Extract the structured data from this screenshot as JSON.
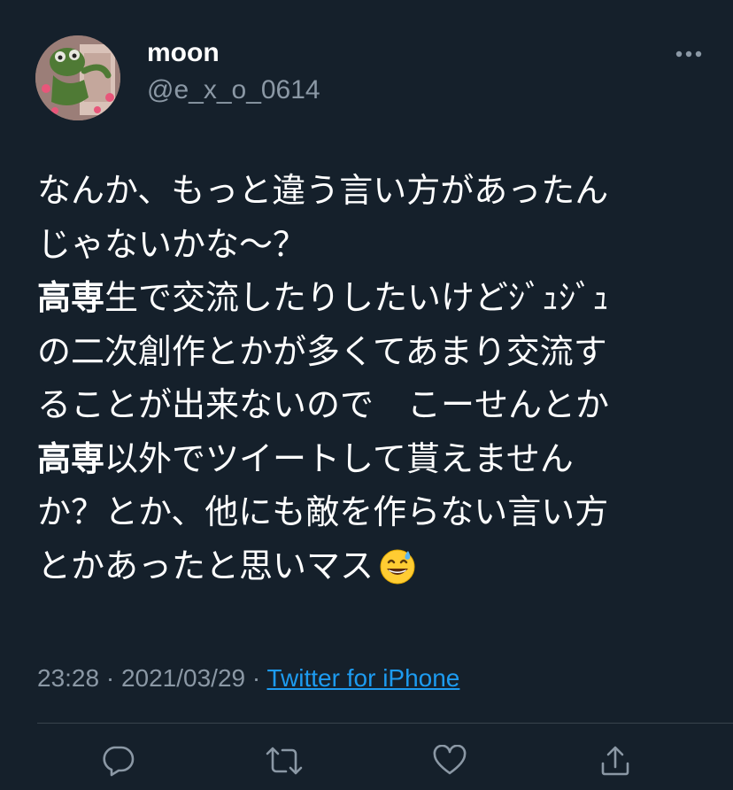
{
  "author": {
    "display_name": "moon",
    "handle": "@e_x_o_0614",
    "avatar_icon": "avatar-photo"
  },
  "tweet": {
    "lines": [
      [
        {
          "text": "なんか、もっと違う言い方があったん",
          "bold": false
        }
      ],
      [
        {
          "text": "じゃないかな〜？",
          "bold": false
        }
      ],
      [
        {
          "text": "高専",
          "bold": true
        },
        {
          "text": "生で交流したりしたいけどｼﾞｭｼﾞｭ",
          "bold": false
        }
      ],
      [
        {
          "text": "の二次創作とかが多くてあまり交流す",
          "bold": false
        }
      ],
      [
        {
          "text": "ることが出来ないので　こーせんとか",
          "bold": false
        }
      ],
      [
        {
          "text": "高専",
          "bold": true
        },
        {
          "text": "以外でツイートして貰えません",
          "bold": false
        }
      ],
      [
        {
          "text": "か？とか、他にも敵を作らない言い方",
          "bold": false
        }
      ],
      [
        {
          "text": "とかあったと思いマス",
          "bold": false
        }
      ]
    ],
    "trailing_emoji": "grinning-sweat-emoji"
  },
  "meta": {
    "time": "23:28",
    "separator": " · ",
    "date": "2021/03/29",
    "source": "Twitter for iPhone"
  },
  "actions": {
    "icons": [
      "reply-icon",
      "retweet-icon",
      "like-icon",
      "share-icon"
    ]
  },
  "colors": {
    "background": "#15202b",
    "text": "#ffffff",
    "secondary": "#8b98a5",
    "link": "#1d9bf0",
    "divider": "#38444d"
  }
}
